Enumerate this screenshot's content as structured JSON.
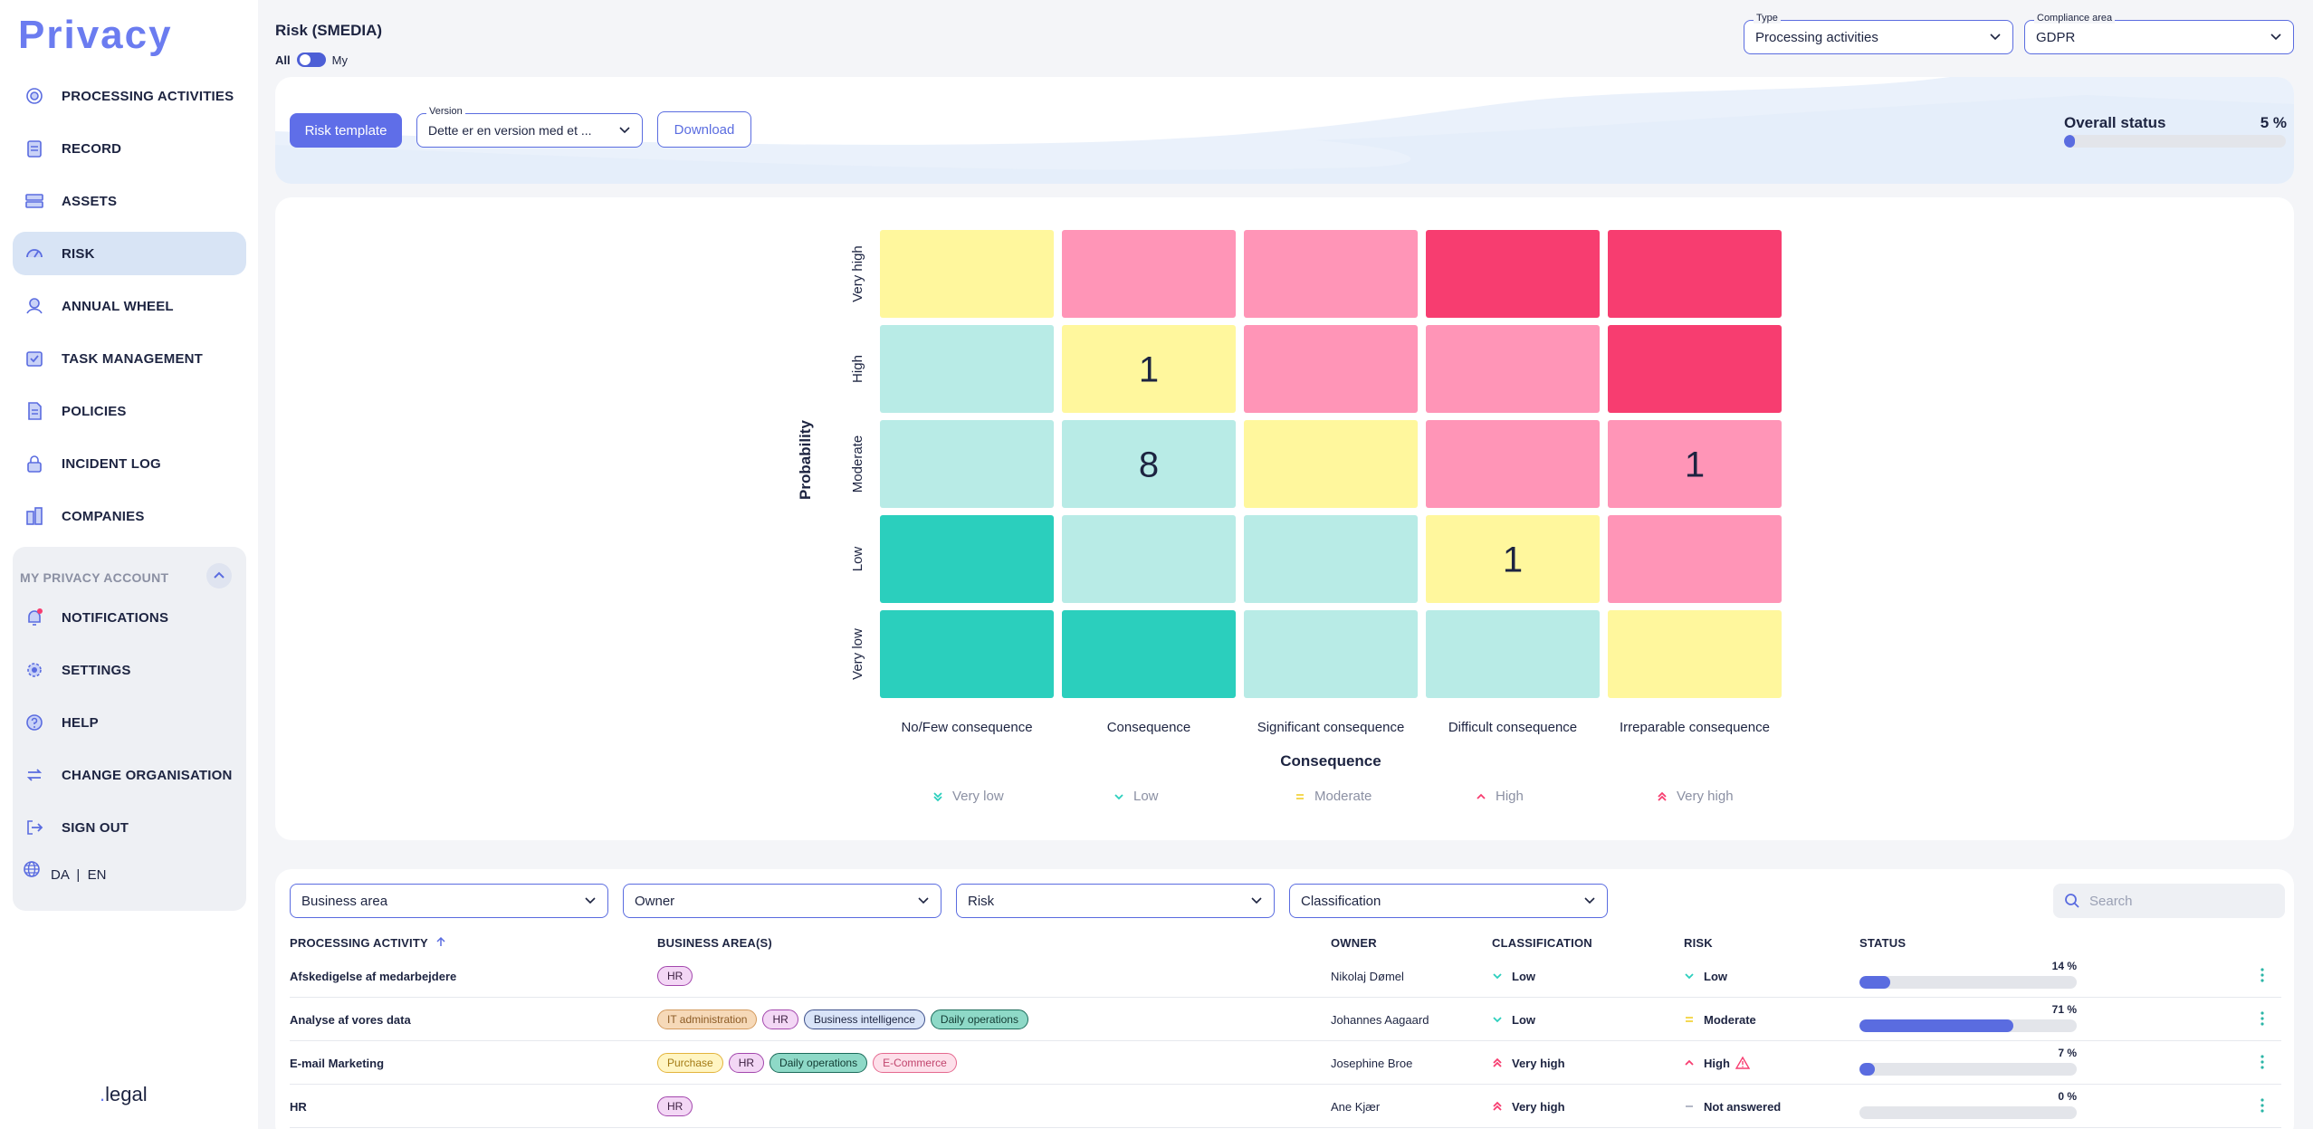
{
  "app": {
    "title": "Privacy",
    "brand_dot": ".",
    "brand_name": "legal"
  },
  "sidebar": {
    "items": [
      {
        "label": "PROCESSING ACTIVITIES",
        "icon": "target-icon"
      },
      {
        "label": "RECORD",
        "icon": "clipboard-icon"
      },
      {
        "label": "ASSETS",
        "icon": "server-icon"
      },
      {
        "label": "RISK",
        "icon": "gauge-icon",
        "active": true
      },
      {
        "label": "ANNUAL WHEEL",
        "icon": "calendar-wheel-icon"
      },
      {
        "label": "TASK MANAGEMENT",
        "icon": "task-icon"
      },
      {
        "label": "POLICIES",
        "icon": "document-icon"
      },
      {
        "label": "INCIDENT LOG",
        "icon": "lock-icon"
      },
      {
        "label": "COMPANIES",
        "icon": "building-icon"
      }
    ],
    "account": {
      "header": "MY PRIVACY ACCOUNT",
      "items": [
        {
          "label": "NOTIFICATIONS",
          "icon": "bell-icon"
        },
        {
          "label": "SETTINGS",
          "icon": "gear-icon"
        },
        {
          "label": "HELP",
          "icon": "help-icon"
        },
        {
          "label": "CHANGE ORGANISATION",
          "icon": "swap-icon"
        },
        {
          "label": "SIGN OUT",
          "icon": "sign-out-icon"
        }
      ],
      "lang": "DA  |  EN"
    }
  },
  "header": {
    "title": "Risk (SMEDIA)",
    "toggle_all": "All",
    "toggle_my": "My",
    "type_label": "Type",
    "type_value": "Processing activities",
    "compliance_label": "Compliance area",
    "compliance_value": "GDPR"
  },
  "toolbar": {
    "risk_template": "Risk template",
    "version_label": "Version",
    "version_value": "Dette er en version med et ...",
    "download": "Download",
    "overall_label": "Overall status",
    "overall_pct_text": "5 %",
    "overall_pct": 5
  },
  "colors": {
    "very_low": "#2bcfbd",
    "low": "#b8ebe6",
    "moderate": "#fff79d",
    "high": "#ff95b7",
    "very_high": "#f73d70",
    "accent": "#5a6ce0"
  },
  "chart_data": {
    "type": "heatmap",
    "ylabel": "Probability",
    "xlabel": "Consequence",
    "rows": [
      "Very high",
      "High",
      "Moderate",
      "Low",
      "Very low"
    ],
    "columns": [
      "No/Few consequence",
      "Consequence",
      "Significant consequence",
      "Difficult consequence",
      "Irreparable consequence"
    ],
    "levels": [
      [
        "moderate",
        "high",
        "high",
        "very_high",
        "very_high"
      ],
      [
        "low",
        "moderate",
        "high",
        "high",
        "very_high"
      ],
      [
        "low",
        "low",
        "moderate",
        "high",
        "high"
      ],
      [
        "very_low",
        "low",
        "low",
        "moderate",
        "high"
      ],
      [
        "very_low",
        "very_low",
        "low",
        "low",
        "moderate"
      ]
    ],
    "counts": [
      [
        "",
        "",
        "",
        "",
        ""
      ],
      [
        "",
        "1",
        "",
        "",
        ""
      ],
      [
        "",
        "8",
        "",
        "",
        "1"
      ],
      [
        "",
        "",
        "",
        "1",
        ""
      ],
      [
        "",
        "",
        "",
        "",
        ""
      ]
    ],
    "legend": [
      {
        "label": "Very low",
        "icon": "double-chevron-down-icon",
        "color": "#2bcfbd"
      },
      {
        "label": "Low",
        "icon": "chevron-down-icon",
        "color": "#2bcfbd"
      },
      {
        "label": "Moderate",
        "icon": "equals-icon",
        "color": "#f2d23c"
      },
      {
        "label": "High",
        "icon": "chevron-up-icon",
        "color": "#f73d70"
      },
      {
        "label": "Very high",
        "icon": "double-chevron-up-icon",
        "color": "#f73d70"
      }
    ]
  },
  "filters": {
    "business_area": "Business area",
    "owner": "Owner",
    "risk": "Risk",
    "classification": "Classification",
    "search_placeholder": "Search"
  },
  "table": {
    "headers": [
      "PROCESSING ACTIVITY",
      "BUSINESS AREA(S)",
      "OWNER",
      "CLASSIFICATION",
      "RISK",
      "STATUS"
    ],
    "rows": [
      {
        "activity": "Afskedigelse af medarbejdere",
        "areas": [
          {
            "name": "HR",
            "kind": "hr"
          }
        ],
        "owner": "Nikolaj Dømel",
        "classification": "Low",
        "class_icon": "chevron-down-icon",
        "risk": "Low",
        "risk_icon": "chevron-down-icon",
        "risk_warning": false,
        "status_text": "14 %",
        "status": 14
      },
      {
        "activity": "Analyse af vores data",
        "areas": [
          {
            "name": "IT administration",
            "kind": "it"
          },
          {
            "name": "HR",
            "kind": "hr"
          },
          {
            "name": "Business intelligence",
            "kind": "bi"
          },
          {
            "name": "Daily operations",
            "kind": "ops"
          }
        ],
        "owner": "Johannes Aagaard",
        "classification": "Low",
        "class_icon": "chevron-down-icon",
        "risk": "Moderate",
        "risk_icon": "equals-icon",
        "risk_warning": false,
        "status_text": "71 %",
        "status": 71
      },
      {
        "activity": "E-mail Marketing",
        "areas": [
          {
            "name": "Purchase",
            "kind": "purchase"
          },
          {
            "name": "HR",
            "kind": "hr"
          },
          {
            "name": "Daily operations",
            "kind": "ops"
          },
          {
            "name": "E-Commerce",
            "kind": "ecom"
          }
        ],
        "owner": "Josephine Broe",
        "classification": "Very high",
        "class_icon": "double-chevron-up-icon",
        "risk": "High",
        "risk_icon": "chevron-up-icon",
        "risk_warning": true,
        "status_text": "7 %",
        "status": 7
      },
      {
        "activity": "HR",
        "areas": [
          {
            "name": "HR",
            "kind": "hr"
          }
        ],
        "owner": "Ane Kjær",
        "classification": "Very high",
        "class_icon": "double-chevron-up-icon",
        "risk": "Not answered",
        "risk_icon": "dash-icon",
        "risk_warning": false,
        "status_text": "0 %",
        "status": 0
      }
    ]
  }
}
